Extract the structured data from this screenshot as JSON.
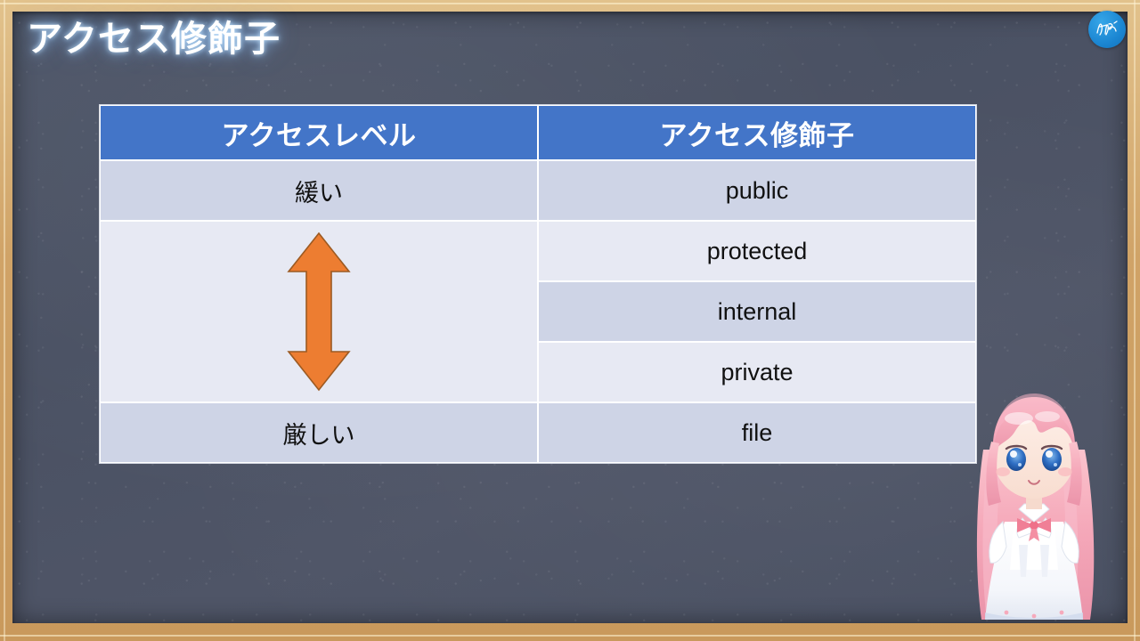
{
  "slide": {
    "title": "アクセス修飾子",
    "board_color": "#4a5163",
    "frame_color": "#d8b075",
    "title_color": "#ffffff",
    "title_glow_color": "#bee1ff"
  },
  "logo": {
    "name": "channel-logo-badge",
    "shape": "circle",
    "background_color": "#1b86d2",
    "mark_color": "#ffffff"
  },
  "table": {
    "header_color": "#4375c8",
    "row_dark_color": "#ced4e6",
    "row_light_color": "#e7e9f3",
    "border_color": "#ffffff",
    "headers": [
      "アクセスレベル",
      "アクセス修飾子"
    ],
    "rows": [
      {
        "level": "緩い",
        "modifier": "public",
        "shade": "dark"
      },
      {
        "level": "",
        "modifier": "protected",
        "shade": "light"
      },
      {
        "level": "",
        "modifier": "internal",
        "shade": "dark"
      },
      {
        "level": "",
        "modifier": "private",
        "shade": "light"
      },
      {
        "level": "厳しい",
        "modifier": "file",
        "shade": "dark"
      }
    ]
  },
  "arrow": {
    "name": "level-range-double-arrow",
    "direction": "up-down",
    "fill_color": "#ed7d31",
    "stroke_color": "#9c5a22",
    "spans_rows": 3,
    "meaning": "アクセスレベルが緩いから厳しいへの範囲"
  },
  "character": {
    "name": "chibi-mascot",
    "hair_color": "#f4a8b8",
    "eye_color": "#2f6fc4",
    "dress_color": "#ffffff",
    "ribbon_color": "#f07f96"
  }
}
